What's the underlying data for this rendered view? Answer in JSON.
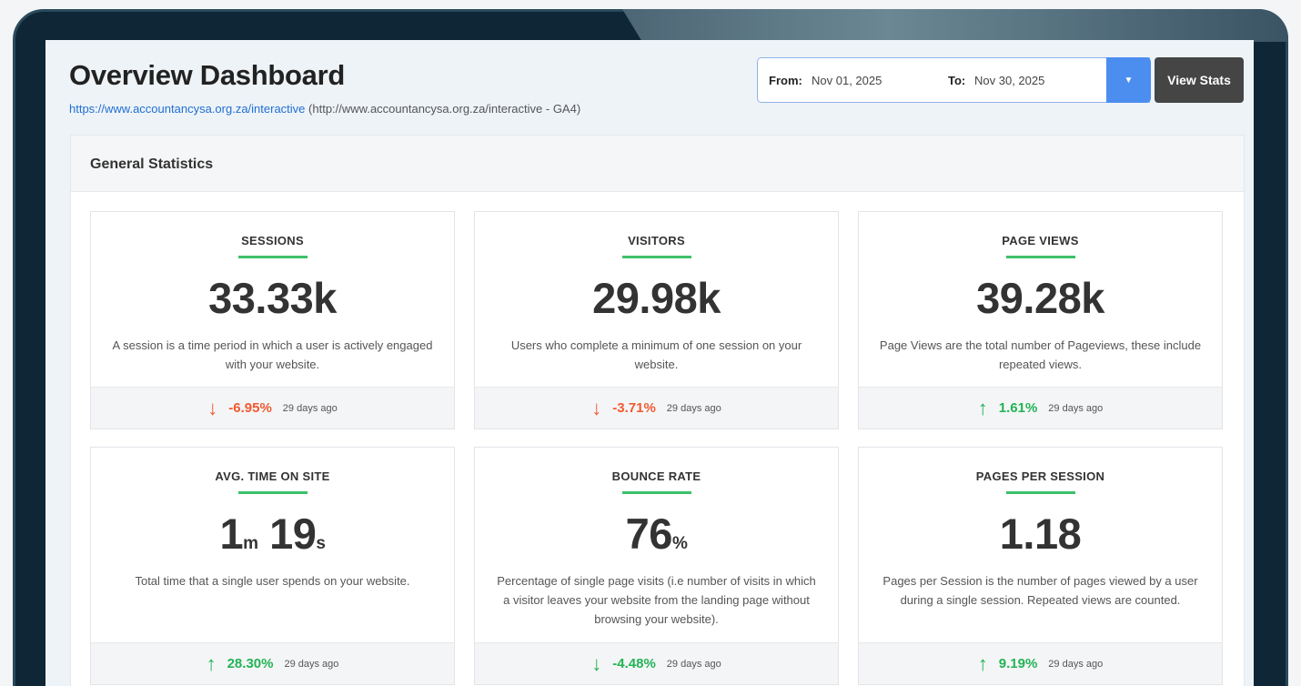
{
  "header": {
    "title": "Overview Dashboard",
    "site_url": "https://www.accountancysa.org.za/interactive",
    "site_suffix": "(http://www.accountancysa.org.za/interactive - GA4)"
  },
  "date_range": {
    "from_label": "From:",
    "from_value": "Nov 01, 2025",
    "to_label": "To:",
    "to_value": "Nov 30, 2025",
    "dropdown_icon": "chevron-down-icon",
    "button_label": "View Stats"
  },
  "panel": {
    "title": "General Statistics"
  },
  "colors": {
    "accent_blue": "#4b8ef0",
    "green": "#23b356",
    "red": "#f15a31",
    "underline": "#3cc16a"
  },
  "cards": [
    {
      "title": "SESSIONS",
      "value": "33.33k",
      "description": "A session is a time period in which a user is actively engaged with your website.",
      "direction": "down",
      "change": "-6.95%",
      "ago": "29 days ago"
    },
    {
      "title": "VISITORS",
      "value": "29.98k",
      "description": "Users who complete a minimum of one session on your website.",
      "direction": "down",
      "change": "-3.71%",
      "ago": "29 days ago"
    },
    {
      "title": "PAGE VIEWS",
      "value": "39.28k",
      "description": "Page Views are the total number of Pageviews, these include repeated views.",
      "direction": "up",
      "change": "1.61%",
      "ago": "29 days ago"
    },
    {
      "title": "AVG. TIME ON SITE",
      "value_parts": [
        "1",
        "m",
        "19",
        "s"
      ],
      "description": "Total time that a single user spends on your website.",
      "direction": "up",
      "change": "28.30%",
      "ago": "29 days ago"
    },
    {
      "title": "BOUNCE RATE",
      "value_parts": [
        "76",
        "%"
      ],
      "description": "Percentage of single page visits (i.e number of visits in which a visitor leaves your website from the landing page without browsing your website).",
      "direction": "down",
      "change": "-4.48%",
      "ago": "29 days ago"
    },
    {
      "title": "PAGES PER SESSION",
      "value": "1.18",
      "description": "Pages per Session is the number of pages viewed by a user during a single session. Repeated views are counted.",
      "direction": "up",
      "change": "9.19%",
      "ago": "29 days ago"
    }
  ]
}
